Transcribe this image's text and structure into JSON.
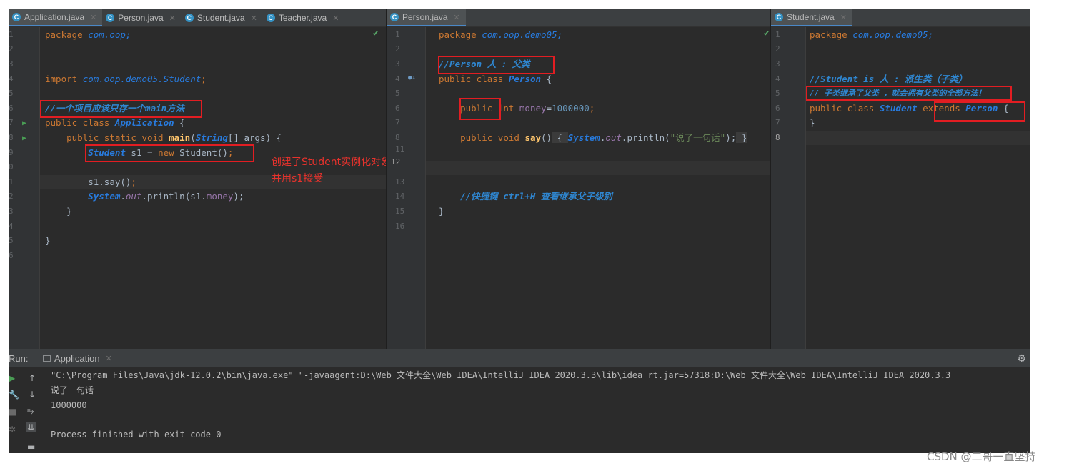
{
  "left_panel": {
    "tabs": [
      "Application.java",
      "Person.java",
      "Student.java",
      "Teacher.java"
    ],
    "line_numbers": [
      "1",
      "2",
      "3",
      "4",
      "5",
      "6",
      "7",
      "8",
      "9",
      "0",
      "1",
      "2",
      "3",
      "4",
      "5",
      "6"
    ],
    "code": {
      "l1_kw": "package",
      "l1_pkg": "com.oop;",
      "l4_kw": "import",
      "l4_pkg": "com.oop.demo05.Student",
      "l4_end": ";",
      "l6_cmt": "//一个项目应该只存一个main方法",
      "l7_kw": "public class",
      "l7_cls": "Application",
      "l7_end": " {",
      "l8_kw": "public static void",
      "l8_fn": "main",
      "l8_p1": "(",
      "l8_type": "String",
      "l8_p2": "[] args) {",
      "l9_cls": "Student",
      "l9_mid": " s1 = ",
      "l9_kw": "new",
      "l9_end": " Student()",
      "l9_semi": ";",
      "l11_a": "s1.say()",
      "l11_semi": ";",
      "l12_cls": "System",
      "l12_dot": ".",
      "l12_out": "out",
      "l12_mid": ".println(s1.",
      "l12_fld": "money",
      "l12_end": ");",
      "l13": "}",
      "l15": "}"
    },
    "annotation_line1": "创建了Student实例化对象",
    "annotation_line2": "并用s1接受"
  },
  "middle_panel": {
    "tab": "Person.java",
    "line_numbers": [
      "1",
      "2",
      "3",
      "4",
      "5",
      "6",
      "7",
      "8",
      "11",
      "12",
      "13",
      "14",
      "15",
      "16"
    ],
    "code": {
      "l1_kw": "package",
      "l1_pkg": "com.oop.demo05;",
      "l3_cmt": "//Person 人 : 父类",
      "l4_kw": "public class",
      "l4_cls": "Person",
      "l4_end": " {",
      "l6_kw": "public",
      "l6_kw2": " int",
      "l6_fld": " money",
      "l6_eq": "=",
      "l6_num": "1000000",
      "l6_semi": ";",
      "l8_kw": "public void",
      "l8_fn": "say",
      "l8_p": "()",
      "l8_b1": " { ",
      "l8_cls": "System",
      "l8_dot": ".",
      "l8_out": "out",
      "l8_mid": ".println(",
      "l8_str": "\"说了一句话\"",
      "l8_end": ");",
      "l8_b2": " }",
      "l14_cmt": "//快捷键 ctrl+H 查看继承父子级别",
      "l15": "}"
    }
  },
  "right_panel": {
    "tab": "Student.java",
    "line_numbers": [
      "1",
      "2",
      "3",
      "4",
      "5",
      "6",
      "7",
      "8"
    ],
    "code": {
      "l1_kw": "package",
      "l1_pkg": "com.oop.demo05;",
      "l4_cmt": "//Student is 人 : 派生类（子类）",
      "l5_cmt": "// 子类继承了父类 ，就会拥有父类的全部方法！",
      "l6_kw": "public class",
      "l6_cls": "Student",
      "l6_kw2": "extends",
      "l6_cls2": "Person",
      "l6_end": " {",
      "l7": "}"
    }
  },
  "run_window": {
    "label": "Run:",
    "tab": "Application",
    "output": [
      "\"C:\\Program Files\\Java\\jdk-12.0.2\\bin\\java.exe\" \"-javaagent:D:\\Web 文件大全\\Web IDEA\\IntelliJ IDEA 2020.3.3\\lib\\idea_rt.jar=57318:D:\\Web 文件大全\\Web IDEA\\IntelliJ IDEA 2020.3.3",
      "说了一句话",
      "1000000",
      "",
      "Process finished with exit code 0"
    ]
  },
  "watermark": "CSDN @二哥一直坚持",
  "icons": {
    "class": "class-c-icon",
    "close": "close-x-icon",
    "check": "checkmark-icon",
    "run": "run-arrow-icon",
    "gear": "gear-icon",
    "up": "arrow-up-icon",
    "down": "arrow-down-icon",
    "wrap": "soft-wrap-icon",
    "scroll": "scroll-to-end-icon",
    "print": "print-icon"
  },
  "colors": {
    "editor_bg": "#2b2b2b",
    "keyword": "#cc7832",
    "class": "#287bde",
    "comment": "#2f86d0",
    "highlight_box": "#e21d22"
  }
}
